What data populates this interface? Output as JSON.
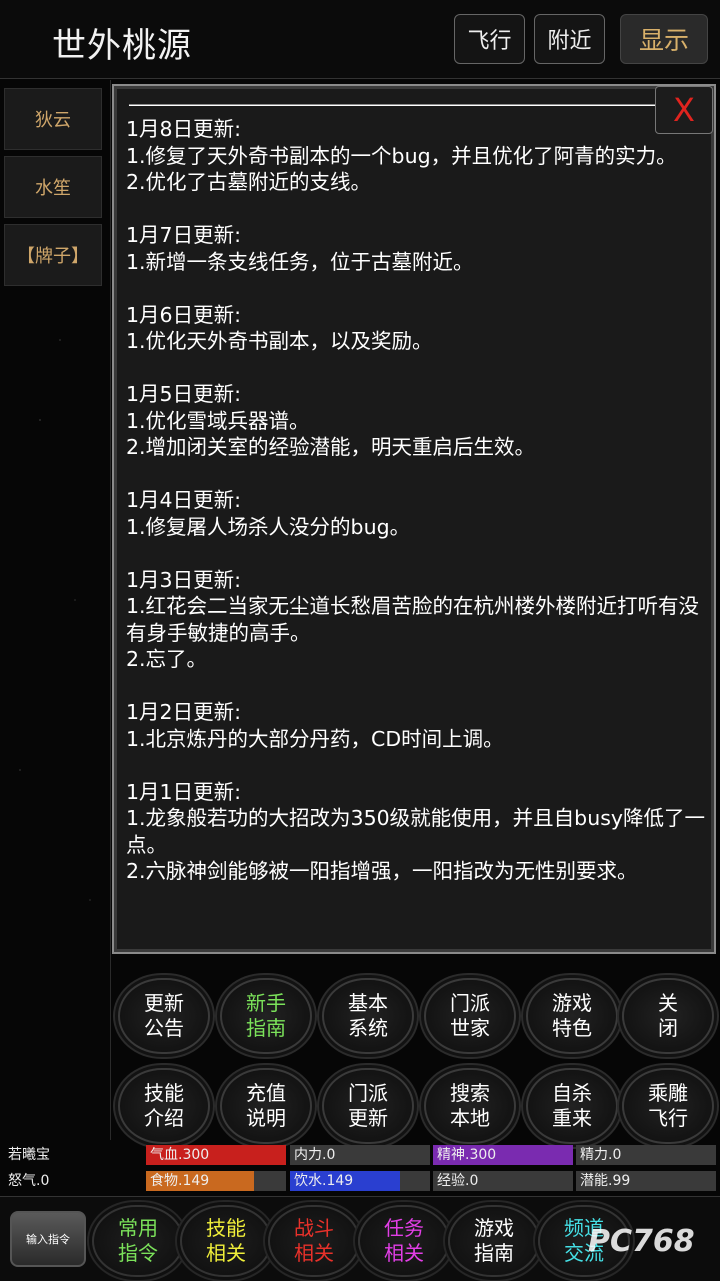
{
  "header": {
    "title": "世外桃源",
    "fly_label": "飞行",
    "nearby_label": "附近",
    "show_label": "显示"
  },
  "npcs": [
    "狄云",
    "水笙",
    "【牌子】"
  ],
  "notice": {
    "dashes": "———————————————————————————————————————",
    "close_label": "X",
    "entries": [
      {
        "date": "1月8日更新:",
        "lines": [
          "1.修复了天外奇书副本的一个bug，并且优化了阿青的实力。",
          "2.优化了古墓附近的支线。"
        ]
      },
      {
        "date": "1月7日更新:",
        "lines": [
          "1.新增一条支线任务，位于古墓附近。"
        ]
      },
      {
        "date": "1月6日更新:",
        "lines": [
          "1.优化天外奇书副本，以及奖励。"
        ]
      },
      {
        "date": "1月5日更新:",
        "lines": [
          "1.优化雪域兵器谱。",
          "2.增加闭关室的经验潜能，明天重启后生效。"
        ]
      },
      {
        "date": "1月4日更新:",
        "lines": [
          "1.修复屠人场杀人没分的bug。"
        ]
      },
      {
        "date": "1月3日更新:",
        "lines": [
          "1.红花会二当家无尘道长愁眉苦脸的在杭州楼外楼附近打听有没有身手敏捷的高手。",
          "2.忘了。"
        ]
      },
      {
        "date": "1月2日更新:",
        "lines": [
          "1.北京炼丹的大部分丹药，CD时间上调。"
        ]
      },
      {
        "date": "1月1日更新:",
        "lines": [
          "1.龙象般若功的大招改为350级就能使用，并且自busy降低了一点。",
          "2.六脉神剑能够被一阳指增强，一阳指改为无性别要求。"
        ]
      }
    ]
  },
  "menu": {
    "row1": [
      {
        "l1": "更新",
        "l2": "公告",
        "color": "#ffffff"
      },
      {
        "l1": "新手",
        "l2": "指南",
        "color": "#7be25a"
      },
      {
        "l1": "基本",
        "l2": "系统",
        "color": "#ffffff"
      },
      {
        "l1": "门派",
        "l2": "世家",
        "color": "#ffffff"
      },
      {
        "l1": "游戏",
        "l2": "特色",
        "color": "#ffffff"
      },
      {
        "l1": "关",
        "l2": "闭",
        "color": "#ffffff"
      }
    ],
    "row2": [
      {
        "l1": "技能",
        "l2": "介绍",
        "color": "#ffffff"
      },
      {
        "l1": "充值",
        "l2": "说明",
        "color": "#ffffff"
      },
      {
        "l1": "门派",
        "l2": "更新",
        "color": "#ffffff"
      },
      {
        "l1": "搜索",
        "l2": "本地",
        "color": "#ffffff"
      },
      {
        "l1": "自杀",
        "l2": "重来",
        "color": "#ffffff"
      },
      {
        "l1": "乘雕",
        "l2": "飞行",
        "color": "#ffffff"
      }
    ]
  },
  "status": {
    "name": "若曦宝",
    "rage": "怒气.0",
    "hp": "气血.300",
    "neili": "内力.0",
    "jingshen": "精神.300",
    "jingli": "精力.0",
    "food": "食物.149",
    "water": "饮水.149",
    "exp": "经验.0",
    "potential": "潜能.99",
    "colors": {
      "hp": "#c8201d",
      "jingshen": "#7a2bb0",
      "food": "#c9691f",
      "water": "#2a3fd0",
      "dark": "#3a3a3a"
    }
  },
  "bottom": {
    "input_label": "输入指令",
    "buttons": [
      {
        "l1": "常用",
        "l2": "指令",
        "color": "#7be25a"
      },
      {
        "l1": "技能",
        "l2": "相关",
        "color": "#f0ef3a"
      },
      {
        "l1": "战斗",
        "l2": "相关",
        "color": "#e8312a"
      },
      {
        "l1": "任务",
        "l2": "相关",
        "color": "#e23ee6"
      },
      {
        "l1": "游戏",
        "l2": "指南",
        "color": "#ffffff"
      },
      {
        "l1": "频道",
        "l2": "交流",
        "color": "#45e0e6"
      }
    ],
    "watermark": "PC768"
  }
}
